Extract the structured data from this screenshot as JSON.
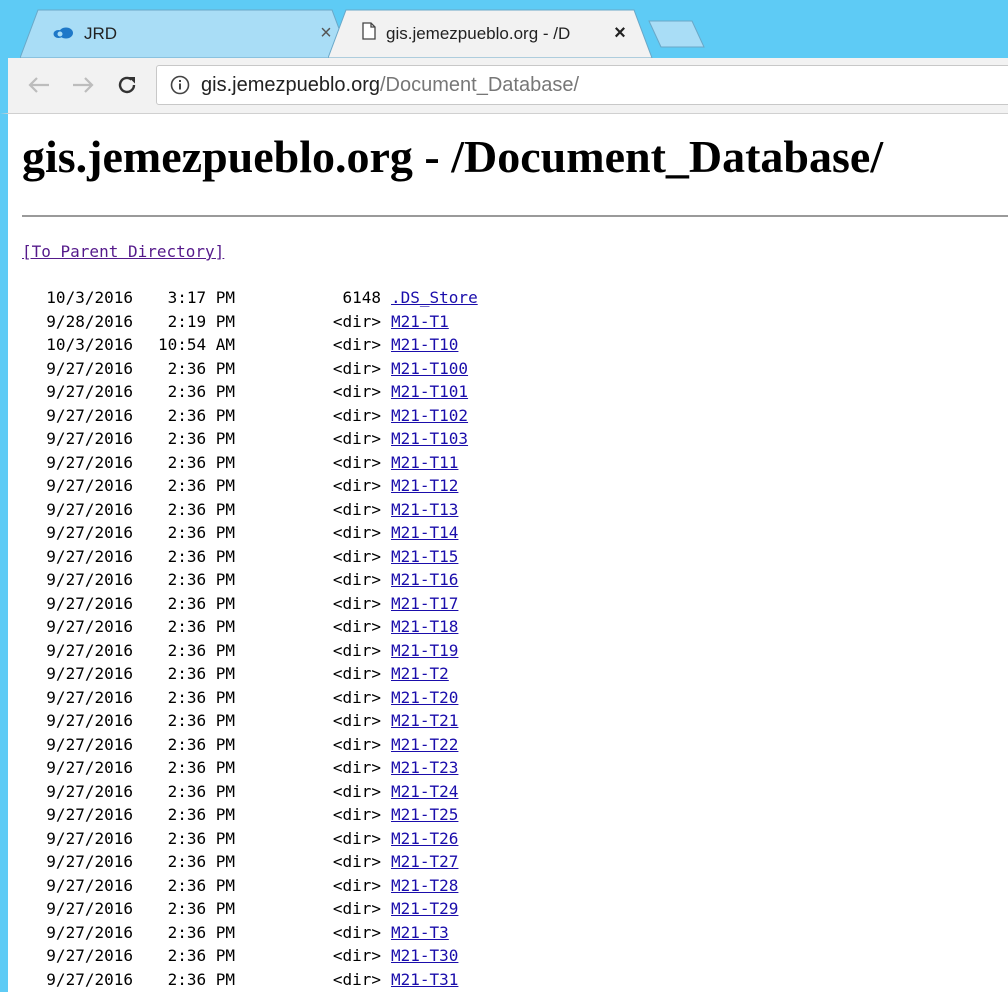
{
  "browser": {
    "tabs": [
      {
        "title": "JRD",
        "icon": "cloud-icon"
      },
      {
        "title": "gis.jemezpueblo.org - /D",
        "icon": "document-icon"
      }
    ],
    "address": {
      "host": "gis.jemezpueblo.org",
      "path": "/Document_Database/"
    },
    "colors": {
      "tabstrip": "#5ecbf5",
      "link": "#1a0dab",
      "visited": "#551a8b"
    }
  },
  "page": {
    "title": "gis.jemezpueblo.org - /Document_Database/",
    "parent_link": "[To Parent Directory]",
    "entries": [
      {
        "date": "10/3/2016",
        "time": "3:17 PM",
        "size": "6148",
        "name": ".DS_Store"
      },
      {
        "date": "9/28/2016",
        "time": "2:19 PM",
        "size": "<dir>",
        "name": "M21-T1"
      },
      {
        "date": "10/3/2016",
        "time": "10:54 AM",
        "size": "<dir>",
        "name": "M21-T10"
      },
      {
        "date": "9/27/2016",
        "time": "2:36 PM",
        "size": "<dir>",
        "name": "M21-T100"
      },
      {
        "date": "9/27/2016",
        "time": "2:36 PM",
        "size": "<dir>",
        "name": "M21-T101"
      },
      {
        "date": "9/27/2016",
        "time": "2:36 PM",
        "size": "<dir>",
        "name": "M21-T102"
      },
      {
        "date": "9/27/2016",
        "time": "2:36 PM",
        "size": "<dir>",
        "name": "M21-T103"
      },
      {
        "date": "9/27/2016",
        "time": "2:36 PM",
        "size": "<dir>",
        "name": "M21-T11"
      },
      {
        "date": "9/27/2016",
        "time": "2:36 PM",
        "size": "<dir>",
        "name": "M21-T12"
      },
      {
        "date": "9/27/2016",
        "time": "2:36 PM",
        "size": "<dir>",
        "name": "M21-T13"
      },
      {
        "date": "9/27/2016",
        "time": "2:36 PM",
        "size": "<dir>",
        "name": "M21-T14"
      },
      {
        "date": "9/27/2016",
        "time": "2:36 PM",
        "size": "<dir>",
        "name": "M21-T15"
      },
      {
        "date": "9/27/2016",
        "time": "2:36 PM",
        "size": "<dir>",
        "name": "M21-T16"
      },
      {
        "date": "9/27/2016",
        "time": "2:36 PM",
        "size": "<dir>",
        "name": "M21-T17"
      },
      {
        "date": "9/27/2016",
        "time": "2:36 PM",
        "size": "<dir>",
        "name": "M21-T18"
      },
      {
        "date": "9/27/2016",
        "time": "2:36 PM",
        "size": "<dir>",
        "name": "M21-T19"
      },
      {
        "date": "9/27/2016",
        "time": "2:36 PM",
        "size": "<dir>",
        "name": "M21-T2"
      },
      {
        "date": "9/27/2016",
        "time": "2:36 PM",
        "size": "<dir>",
        "name": "M21-T20"
      },
      {
        "date": "9/27/2016",
        "time": "2:36 PM",
        "size": "<dir>",
        "name": "M21-T21"
      },
      {
        "date": "9/27/2016",
        "time": "2:36 PM",
        "size": "<dir>",
        "name": "M21-T22"
      },
      {
        "date": "9/27/2016",
        "time": "2:36 PM",
        "size": "<dir>",
        "name": "M21-T23"
      },
      {
        "date": "9/27/2016",
        "time": "2:36 PM",
        "size": "<dir>",
        "name": "M21-T24"
      },
      {
        "date": "9/27/2016",
        "time": "2:36 PM",
        "size": "<dir>",
        "name": "M21-T25"
      },
      {
        "date": "9/27/2016",
        "time": "2:36 PM",
        "size": "<dir>",
        "name": "M21-T26"
      },
      {
        "date": "9/27/2016",
        "time": "2:36 PM",
        "size": "<dir>",
        "name": "M21-T27"
      },
      {
        "date": "9/27/2016",
        "time": "2:36 PM",
        "size": "<dir>",
        "name": "M21-T28"
      },
      {
        "date": "9/27/2016",
        "time": "2:36 PM",
        "size": "<dir>",
        "name": "M21-T29"
      },
      {
        "date": "9/27/2016",
        "time": "2:36 PM",
        "size": "<dir>",
        "name": "M21-T3"
      },
      {
        "date": "9/27/2016",
        "time": "2:36 PM",
        "size": "<dir>",
        "name": "M21-T30"
      },
      {
        "date": "9/27/2016",
        "time": "2:36 PM",
        "size": "<dir>",
        "name": "M21-T31"
      }
    ]
  }
}
